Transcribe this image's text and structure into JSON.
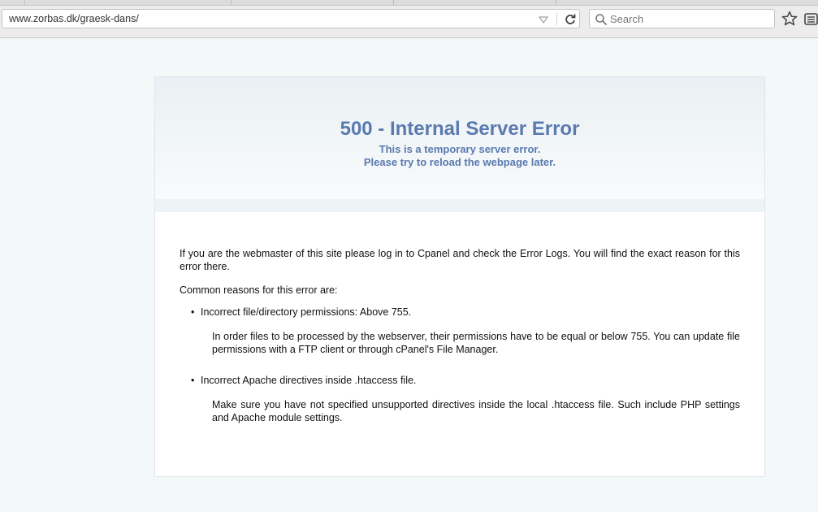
{
  "browser": {
    "url": "www.zorbas.dk/graesk-dans/",
    "search_placeholder": "Search"
  },
  "error": {
    "title": "500 - Internal Server Error",
    "subtitle_line1": "This is a temporary server error.",
    "subtitle_line2": "Please try to reload the webpage later."
  },
  "content": {
    "intro": "If you are the webmaster of this site please log in to Cpanel and check the Error Logs. You will find the exact reason for this error there.",
    "common_reasons": "Common reasons for this error are:",
    "reasons": [
      {
        "title": "Incorrect file/directory permissions: Above 755.",
        "detail": "In order files to be processed by the webserver, their permissions have to be equal or below 755. You can update file permissions with a FTP client or through cPanel's File Manager."
      },
      {
        "title": "Incorrect Apache directives inside .htaccess file.",
        "detail": "Make sure you have not specified unsupported directives inside the local .htaccess file. Such include PHP settings and Apache module settings."
      }
    ]
  },
  "colors": {
    "accent": "#5a7ab0",
    "page_bg": "#f3f8f9"
  },
  "icons": [
    "chevron-down-icon",
    "reload-icon",
    "search-icon",
    "star-icon",
    "reader-icon"
  ]
}
